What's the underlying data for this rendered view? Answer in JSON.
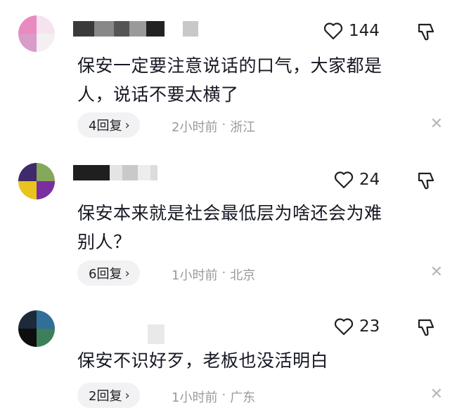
{
  "comments": [
    {
      "likes": "144",
      "text_line1": "保安一定要注意说话的口气，大家都是",
      "text_line2": "人，说话不要太横了",
      "reply": "4回复",
      "time": "2小时前",
      "dot": "·",
      "location": "浙江"
    },
    {
      "likes": "24",
      "text_line1": "保安本来就是社会最低层为啥还会为难",
      "text_line2": "别人？",
      "reply": "6回复",
      "time": "1小时前",
      "dot": "·",
      "location": "北京"
    },
    {
      "likes": "23",
      "text_line1": "保安不识好歹，老板也没活明白",
      "reply": "2回复",
      "time": "1小时前",
      "dot": "·",
      "location": "广东"
    }
  ],
  "icons": {
    "like": "heart-outline-icon",
    "dislike": "thumbs-down-icon",
    "close": "close-icon",
    "chevron": "›",
    "close_glyph": "✕"
  },
  "colors": {
    "text": "#161823",
    "meta": "#9a9a9e",
    "pill_bg": "#f2f2f4"
  }
}
